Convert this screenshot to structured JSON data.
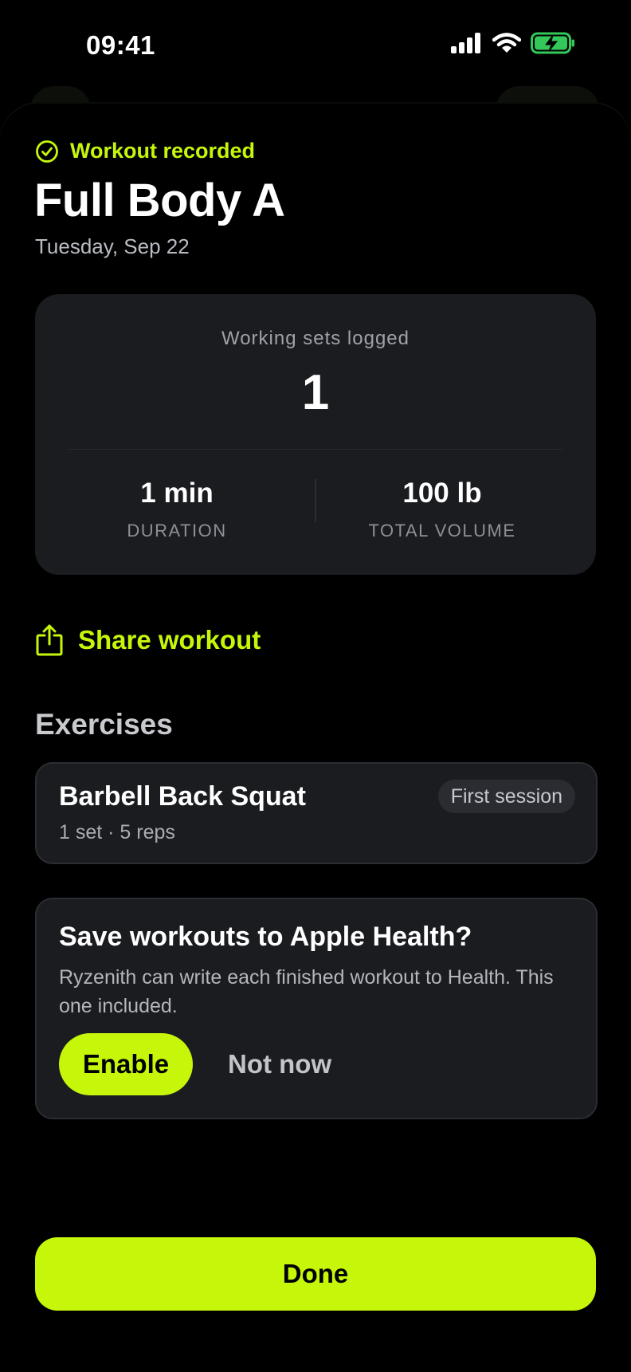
{
  "status_bar": {
    "time": "09:41"
  },
  "header": {
    "recorded_label": "Workout recorded",
    "title": "Full Body A",
    "date": "Tuesday, Sep 22"
  },
  "summary": {
    "caption": "Working sets logged",
    "sets_logged": "1",
    "duration_value": "1 min",
    "duration_label": "DURATION",
    "volume_value": "100 lb",
    "volume_label": "TOTAL VOLUME"
  },
  "share_label": "Share workout",
  "exercises": {
    "heading": "Exercises",
    "items": [
      {
        "name": "Barbell Back Squat",
        "meta": "1 set · 5 reps",
        "badge": "First session"
      }
    ]
  },
  "health_prompt": {
    "title": "Save workouts to Apple Health?",
    "description": "Ryzenith can write each finished workout to Health. This one included.",
    "enable_label": "Enable",
    "dismiss_label": "Not now"
  },
  "done_label": "Done",
  "colors": {
    "accent": "#c6f70a",
    "card": "#1b1c20",
    "background": "#000000"
  }
}
